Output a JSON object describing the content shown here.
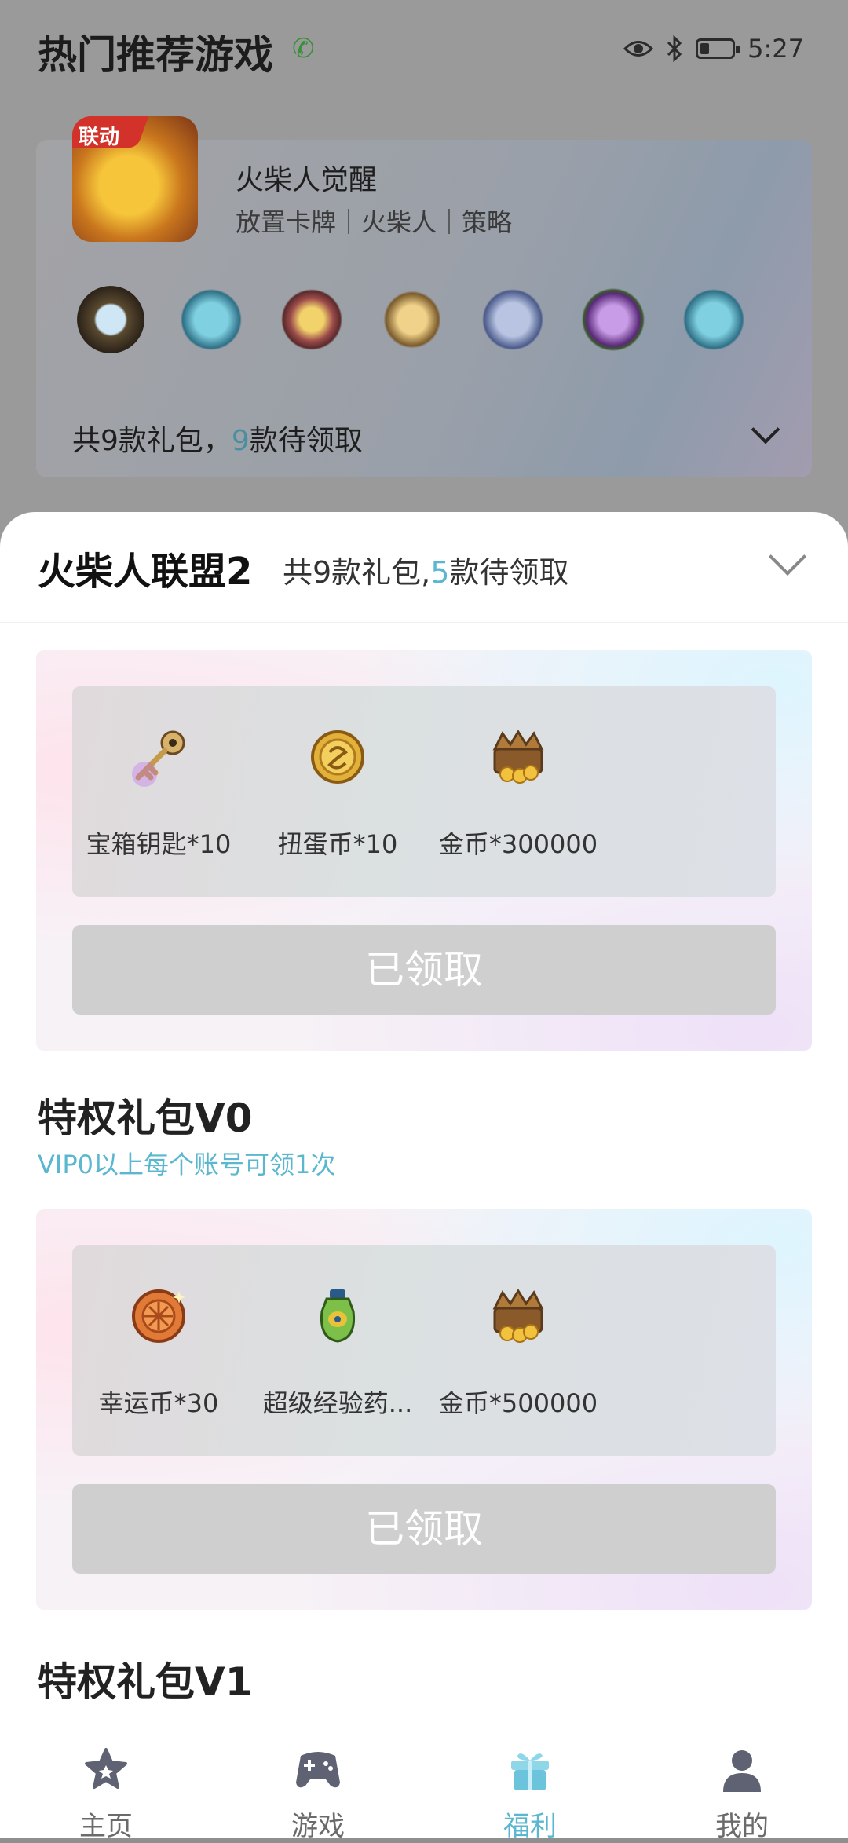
{
  "background": {
    "page_title": "热门推荐游戏",
    "status_bar": {
      "time": "5:27"
    },
    "game_card": {
      "thumb_badge": "联动",
      "name": "火柴人觉醒",
      "tags": "放置卡牌｜火柴人｜策略",
      "footer_prefix": "共9款礼包，",
      "footer_count": "9",
      "footer_suffix": "款待领取"
    }
  },
  "sheet": {
    "title": "火柴人联盟2",
    "summary_prefix": "共9款礼包,",
    "summary_count": "5",
    "summary_suffix": "款待领取",
    "packs": [
      {
        "items": [
          {
            "label": "宝箱钥匙*10",
            "icon": "key-icon"
          },
          {
            "label": "扭蛋币*10",
            "icon": "gold-coin-icon"
          },
          {
            "label": "金币*300000",
            "icon": "treasure-chest-icon"
          }
        ],
        "button_label": "已领取"
      },
      {
        "title": "特权礼包V0",
        "subtitle": "VIP0以上每个账号可领1次",
        "items": [
          {
            "label": "幸运币*30",
            "icon": "lucky-coin-icon"
          },
          {
            "label": "超级经验药...",
            "icon": "potion-icon"
          },
          {
            "label": "金币*500000",
            "icon": "treasure-chest-icon"
          }
        ],
        "button_label": "已领取"
      },
      {
        "title": "特权礼包V1"
      }
    ]
  },
  "nav": {
    "items": [
      {
        "label": "主页",
        "icon": "star-icon"
      },
      {
        "label": "游戏",
        "icon": "gamepad-icon"
      },
      {
        "label": "福利",
        "icon": "gift-icon",
        "active": true
      },
      {
        "label": "我的",
        "icon": "person-icon"
      }
    ]
  },
  "colors": {
    "accent": "#5ab7cf",
    "button_disabled": "#cfcfcf"
  }
}
